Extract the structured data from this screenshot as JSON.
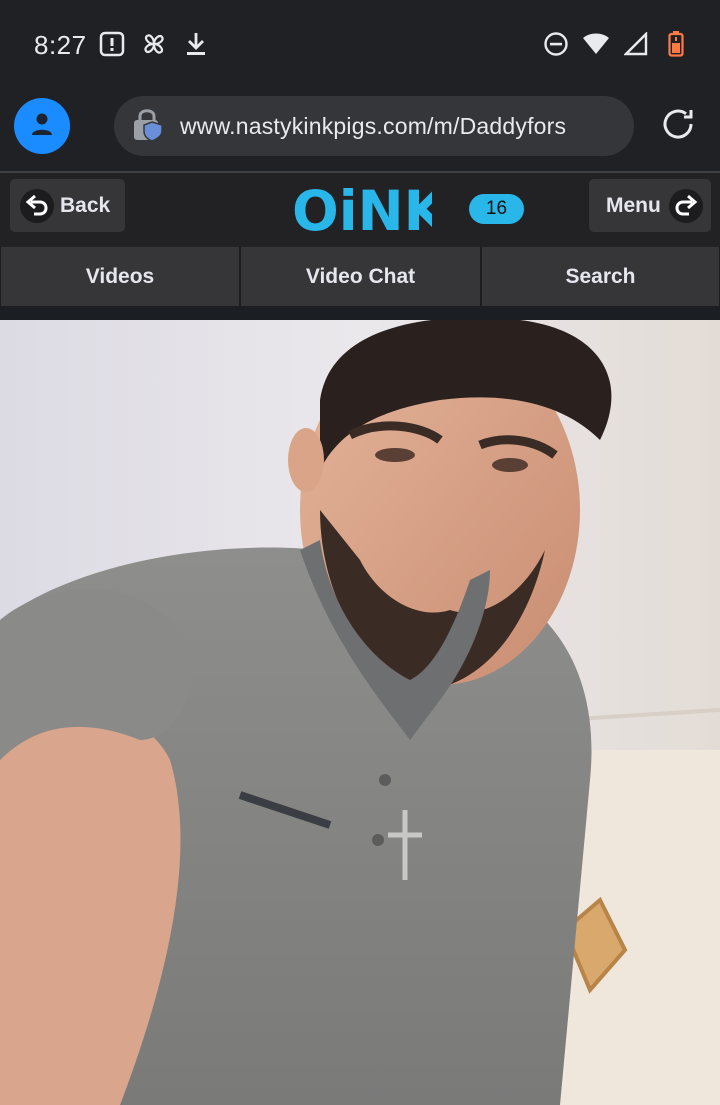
{
  "status_bar": {
    "time": "8:27",
    "left_icons": [
      "alert-box-icon",
      "pinwheel-icon",
      "download-icon"
    ],
    "right_icons": [
      "do-not-disturb-icon",
      "wifi-icon",
      "signal-icon",
      "battery-low-icon"
    ]
  },
  "browser": {
    "url": "www.nastykinkpigs.com/m/Daddyfors",
    "profile_icon": "person-icon",
    "site_info_icon": "shield-lock-icon",
    "reload_icon": "reload-icon"
  },
  "site_header": {
    "back_label": "Back",
    "menu_label": "Menu",
    "logo_text": "OiNK",
    "notification_count": "16",
    "accent_color": "#29b6e8"
  },
  "nav": {
    "tabs": [
      {
        "label": "Videos"
      },
      {
        "label": "Video Chat"
      },
      {
        "label": "Search"
      }
    ]
  },
  "video": {
    "content": "live-video-feed"
  }
}
